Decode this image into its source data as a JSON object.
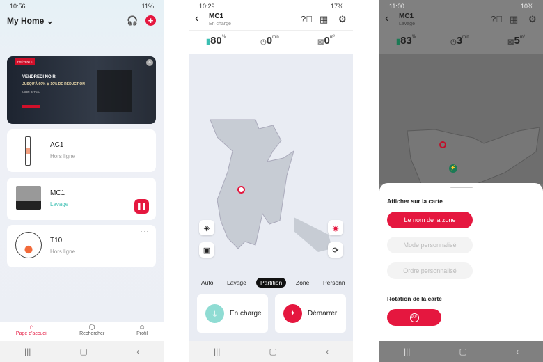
{
  "home": {
    "status": {
      "time": "10:56",
      "battery": "11%"
    },
    "title": "My Home",
    "banner": {
      "badge": "PRÉVENTE",
      "title": "VENDREDI NOIR",
      "subtitle": "JUSQU'À 60% ⊕ 10% DE RÉDUCTION",
      "code": "Code: BFPGO"
    },
    "devices": [
      {
        "name": "AC1",
        "status": "Hors ligne"
      },
      {
        "name": "MC1",
        "status": "Lavage"
      },
      {
        "name": "T10",
        "status": "Hors ligne"
      }
    ],
    "tabs": [
      {
        "label": "Page d'accueil",
        "icon": "home-icon"
      },
      {
        "label": "Rechercher",
        "icon": "search-icon"
      },
      {
        "label": "Profil",
        "icon": "profile-icon"
      }
    ]
  },
  "mc1": {
    "status": {
      "time": "10:29",
      "battery": "17%"
    },
    "title": "MC1",
    "subtitle": "En charge",
    "battery": "80",
    "battery_unit": "%",
    "time": "0",
    "time_unit": "min",
    "area": "0",
    "area_unit": "m²",
    "modes": [
      "Auto",
      "Lavage",
      "Partition",
      "Zone",
      "Personn"
    ],
    "selected_mode": "Partition",
    "charge_label": "En charge",
    "start_label": "Démarrer"
  },
  "sheet": {
    "status": {
      "time": "11:00",
      "battery": "10%"
    },
    "title": "MC1",
    "subtitle": "Lavage",
    "battery": "83",
    "battery_unit": "%",
    "time": "3",
    "time_unit": "min",
    "area": "5",
    "area_unit": "m²",
    "show_heading": "Afficher sur la carte",
    "options": [
      "Le nom de la zone",
      "Mode personnalisé",
      "Ordre personnalisé"
    ],
    "rotation_heading": "Rotation de la carte",
    "rotation_label": "90°"
  },
  "colors": {
    "accent": "#e5173f",
    "teal": "#3bbfb2",
    "charge": "#8fdcd3"
  }
}
